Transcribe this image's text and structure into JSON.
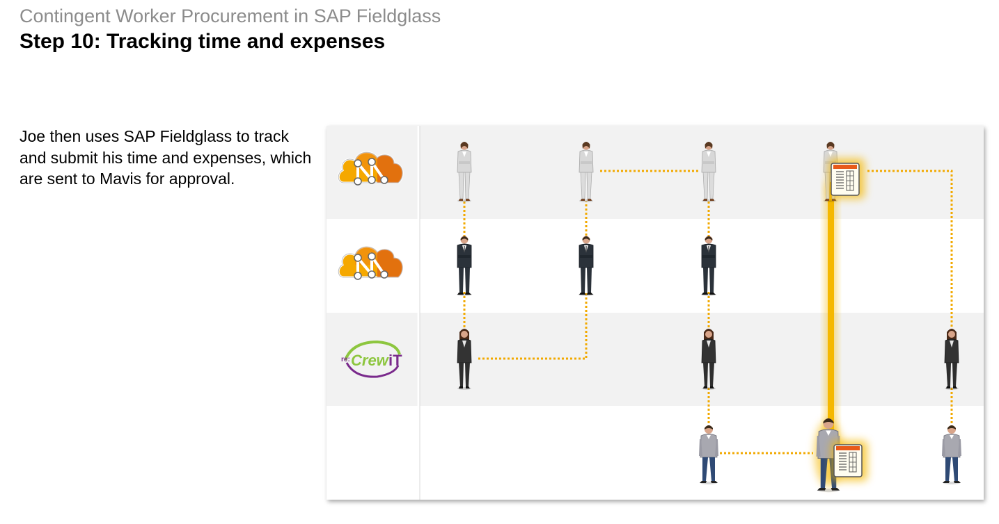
{
  "header": {
    "subtitle": "Contingent Worker Procurement in SAP Fieldglass",
    "title": "Step 10: Tracking time and expenses"
  },
  "description": "Joe then uses SAP Fieldglass to track and submit his time and expenses, which are sent to Mavis for approval.",
  "lanes": [
    {
      "logo": "sap-fieldglass-cloud-icon",
      "people": "businesswoman-light-suit"
    },
    {
      "logo": "sap-fieldglass-cloud-icon",
      "people": "businessman-dark-suit"
    },
    {
      "logo": "recrewit",
      "people": "businesswoman-dark-suit"
    },
    {
      "logo": "none",
      "people": "contingent-worker-joe"
    }
  ],
  "logos": {
    "recrewit_prefix": "re:",
    "recrewit_main": "Crew",
    "recrewit_suffix": "iT"
  },
  "colors": {
    "connector": "#f2a900",
    "highlight": "#f5b800",
    "lane_shade": "#f2f2f2",
    "cloud_orange": "#e8730c",
    "cloud_yellow": "#f5a800",
    "crew_green": "#8dc63f",
    "crew_purple": "#7a2a8c"
  }
}
